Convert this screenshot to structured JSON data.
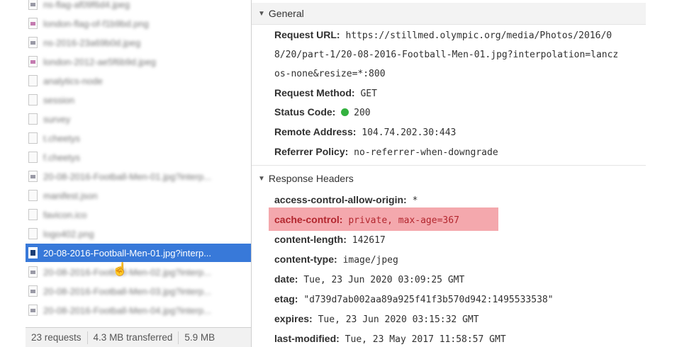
{
  "requests": [
    {
      "name": "ns-flag-af09f6d4.jpeg",
      "blurred": true,
      "icon": "image-file-icon"
    },
    {
      "name": "london-flag-of-f1b9bd.png",
      "blurred": true,
      "icon": "image-file-icon"
    },
    {
      "name": "ns-2016-23a69b0d.jpeg",
      "blurred": true,
      "icon": "image-file-icon"
    },
    {
      "name": "london-2012-ae5f6b9d.jpeg",
      "blurred": true,
      "icon": "image-file-icon"
    },
    {
      "name": "analytics-node",
      "blurred": true,
      "icon": "document-icon"
    },
    {
      "name": "session",
      "blurred": true,
      "icon": "document-icon"
    },
    {
      "name": "survey",
      "blurred": true,
      "icon": "document-icon"
    },
    {
      "name": "t.cheetys",
      "blurred": true,
      "icon": "document-icon"
    },
    {
      "name": "f.cheetys",
      "blurred": true,
      "icon": "document-icon"
    },
    {
      "name": "20-08-2016-Football-Men-01.jpg?interp...",
      "blurred": true,
      "icon": "image-file-icon"
    },
    {
      "name": "manifest.json",
      "blurred": true,
      "icon": "document-icon"
    },
    {
      "name": "favicon.ico",
      "blurred": true,
      "icon": "document-icon"
    },
    {
      "name": "logo402.png",
      "blurred": true,
      "icon": "document-icon"
    },
    {
      "name": "20-08-2016-Football-Men-01.jpg?interp...",
      "blurred": false,
      "selected": true,
      "icon": "image-file-icon"
    },
    {
      "name": "20-08-2016-Football-Men-02.jpg?interp...",
      "blurred": true,
      "icon": "image-file-icon"
    },
    {
      "name": "20-08-2016-Football-Men-03.jpg?interp...",
      "blurred": true,
      "icon": "image-file-icon"
    },
    {
      "name": "20-08-2016-Football-Men-04.jpg?interp...",
      "blurred": true,
      "icon": "image-file-icon"
    }
  ],
  "status_bar": {
    "requests": "23 requests",
    "transferred": "4.3 MB transferred",
    "size": "5.9 MB"
  },
  "general": {
    "title": "General",
    "request_url_label": "Request URL:",
    "request_url_line1": "https://stillmed.olympic.org/media/Photos/2016/0",
    "request_url_line2": "8/20/part-1/20-08-2016-Football-Men-01.jpg?interpolation=lancz",
    "request_url_line3": "os-none&resize=*:800",
    "request_method_label": "Request Method:",
    "request_method": "GET",
    "status_code_label": "Status Code:",
    "status_code": "200",
    "status_color": "#33b13f",
    "remote_address_label": "Remote Address:",
    "remote_address": "104.74.202.30:443",
    "referrer_policy_label": "Referrer Policy:",
    "referrer_policy": "no-referrer-when-downgrade"
  },
  "response_headers": {
    "title": "Response Headers",
    "items": [
      {
        "key": "access-control-allow-origin:",
        "value": "*"
      },
      {
        "key": "cache-control:",
        "value": "private, max-age=367",
        "highlighted": true
      },
      {
        "key": "content-length:",
        "value": "142617"
      },
      {
        "key": "content-type:",
        "value": "image/jpeg"
      },
      {
        "key": "date:",
        "value": "Tue, 23 Jun 2020 03:09:25 GMT"
      },
      {
        "key": "etag:",
        "value": "\"d739d7ab002aa89a925f41f3b570d942:1495533538\""
      },
      {
        "key": "expires:",
        "value": "Tue, 23 Jun 2020 03:15:32 GMT"
      },
      {
        "key": "last-modified:",
        "value": "Tue, 23 May 2017 11:58:57 GMT"
      }
    ]
  },
  "colors": {
    "selected_row": "#3879d9",
    "highlight": "#f4a8ad"
  }
}
